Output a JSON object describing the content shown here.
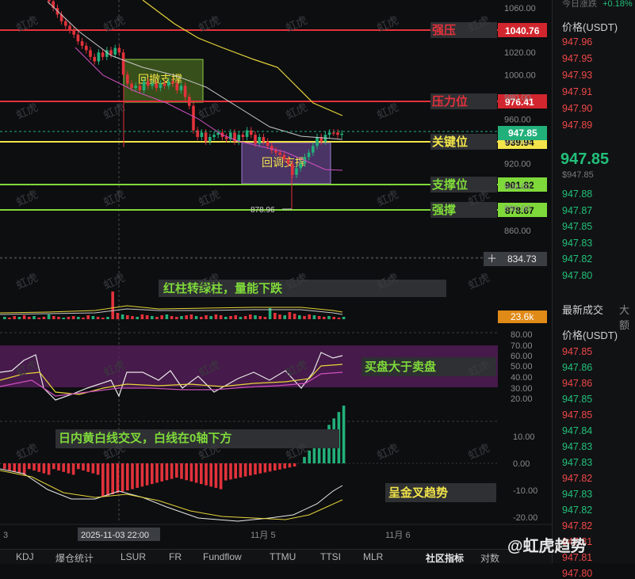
{
  "header": {
    "change_label": "今日涨跌",
    "change_value": "+0.18%"
  },
  "price_axis": {
    "ticks": [
      "1060.00",
      "1020.00",
      "1000.00",
      "980.00",
      "960.00",
      "940.00",
      "920.00",
      "900.00",
      "880.00",
      "860.00",
      "840.00"
    ]
  },
  "levels": [
    {
      "name": "强压",
      "value": "1040.76",
      "color": "#e2323b",
      "tag_color": "#d2262e"
    },
    {
      "name": "压力位",
      "value": "976.41",
      "color": "#e2323b",
      "tag_color": "#d2262e"
    },
    {
      "name": "关键位",
      "value": "939.94",
      "color": "#f2e44a",
      "tag_color": "#f2e44a"
    },
    {
      "name": "支撑位",
      "value": "901.82",
      "color": "#7fd93a",
      "tag_color": "#7fd93a"
    },
    {
      "name": "强撑",
      "value": "878.67",
      "color": "#7fd93a",
      "tag_color": "#7fd93a"
    }
  ],
  "current_price_tag": "947.85",
  "crosshair_price_tag": "834.73",
  "low_marker": "878.96",
  "zones": [
    {
      "label": "回撤支撑"
    },
    {
      "label": "回调支撑"
    }
  ],
  "volume": {
    "annotation": "红柱转绿柱，量能下跌",
    "value_tag": "23.6k"
  },
  "kdj": {
    "annotation": "买盘大于卖盘",
    "ticks": [
      "80.00",
      "70.00",
      "60.00",
      "50.00",
      "40.00",
      "30.00",
      "20.00"
    ]
  },
  "macd": {
    "annotation": "日内黄白线交叉，白线在0轴下方",
    "annotation2": "呈金叉趋势",
    "ticks": [
      "10.00",
      "0.00",
      "-10.00",
      "-20.00"
    ]
  },
  "time_axis": {
    "crosshair_time": "2025-11-03 22:00",
    "labels": [
      "3",
      "11月 5",
      "11月 6"
    ]
  },
  "tabs": [
    "KDJ",
    "爆仓统计",
    "LSUR",
    "FR",
    "Fundflow",
    "TTMU",
    "TTSI",
    "MLR",
    "社区指标",
    "对数"
  ],
  "right_panel": {
    "price_header": "价格(USDT)",
    "asks": [
      "947.96",
      "947.95",
      "947.93",
      "947.91",
      "947.90",
      "947.89"
    ],
    "last_price": "947.85",
    "last_price_sub": "$947.85",
    "bids": [
      "947.88",
      "947.87",
      "947.85",
      "947.83",
      "947.82",
      "947.80"
    ],
    "trades_title": "最新成交",
    "trades_tab2": "大额",
    "trades_header": "价格(USDT)",
    "trades": [
      {
        "p": "947.85",
        "side": "sell"
      },
      {
        "p": "947.86",
        "side": "buy"
      },
      {
        "p": "947.86",
        "side": "sell"
      },
      {
        "p": "947.85",
        "side": "buy"
      },
      {
        "p": "947.85",
        "side": "sell"
      },
      {
        "p": "947.84",
        "side": "buy"
      },
      {
        "p": "947.83",
        "side": "buy"
      },
      {
        "p": "947.83",
        "side": "buy"
      },
      {
        "p": "947.82",
        "side": "sell"
      },
      {
        "p": "947.83",
        "side": "buy"
      },
      {
        "p": "947.82",
        "side": "buy"
      },
      {
        "p": "947.82",
        "side": "sell"
      },
      {
        "p": "947.81",
        "side": "sell"
      },
      {
        "p": "947.81",
        "side": "sell"
      },
      {
        "p": "947.80",
        "side": "sell"
      }
    ]
  },
  "watermark": "虹虎",
  "brand": "@虹虎趋势"
}
